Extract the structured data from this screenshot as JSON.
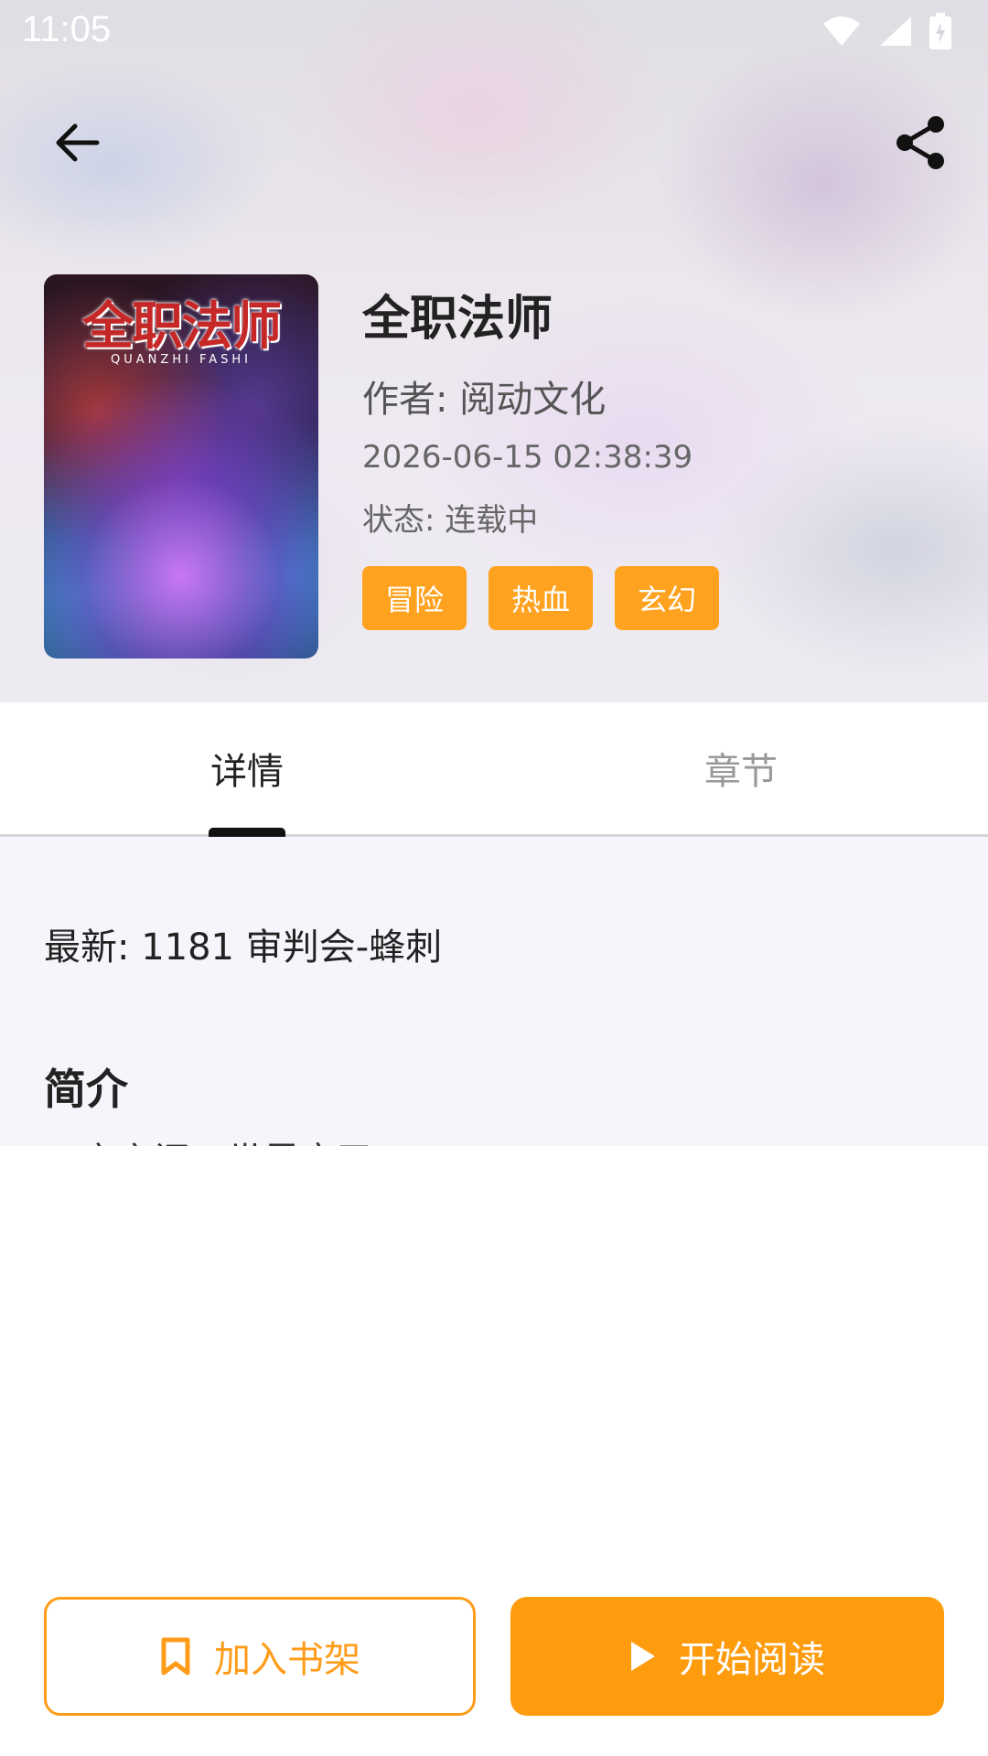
{
  "status_bar": {
    "time": "11:05"
  },
  "book": {
    "cover_title": "全职法师",
    "cover_subtitle": "QUANZHI FASHI",
    "title": "全职法师",
    "author_label": "作者: 阅动文化",
    "update_time": "2026-06-15 02:38:39",
    "status_label": "状态: 连载中",
    "tags": [
      "冒险",
      "热血",
      "玄幻"
    ]
  },
  "tabs": [
    {
      "label": "详情",
      "selected": true
    },
    {
      "label": "章节",
      "selected": false
    }
  ],
  "details": {
    "latest": "最新: 1181 审判会-蜂刺",
    "intro_heading": "简介",
    "intro_preview": "一夜之间，世界变了……"
  },
  "actions": {
    "add_to_shelf": "加入书架",
    "start_reading": "开始阅读"
  },
  "colors": {
    "accent": "#ff9c0e",
    "tag_bg": "#ffa21f"
  },
  "icons": {
    "back": "arrow-left-icon",
    "share": "share-icon",
    "bookmark": "bookmark-icon",
    "play": "play-icon"
  }
}
